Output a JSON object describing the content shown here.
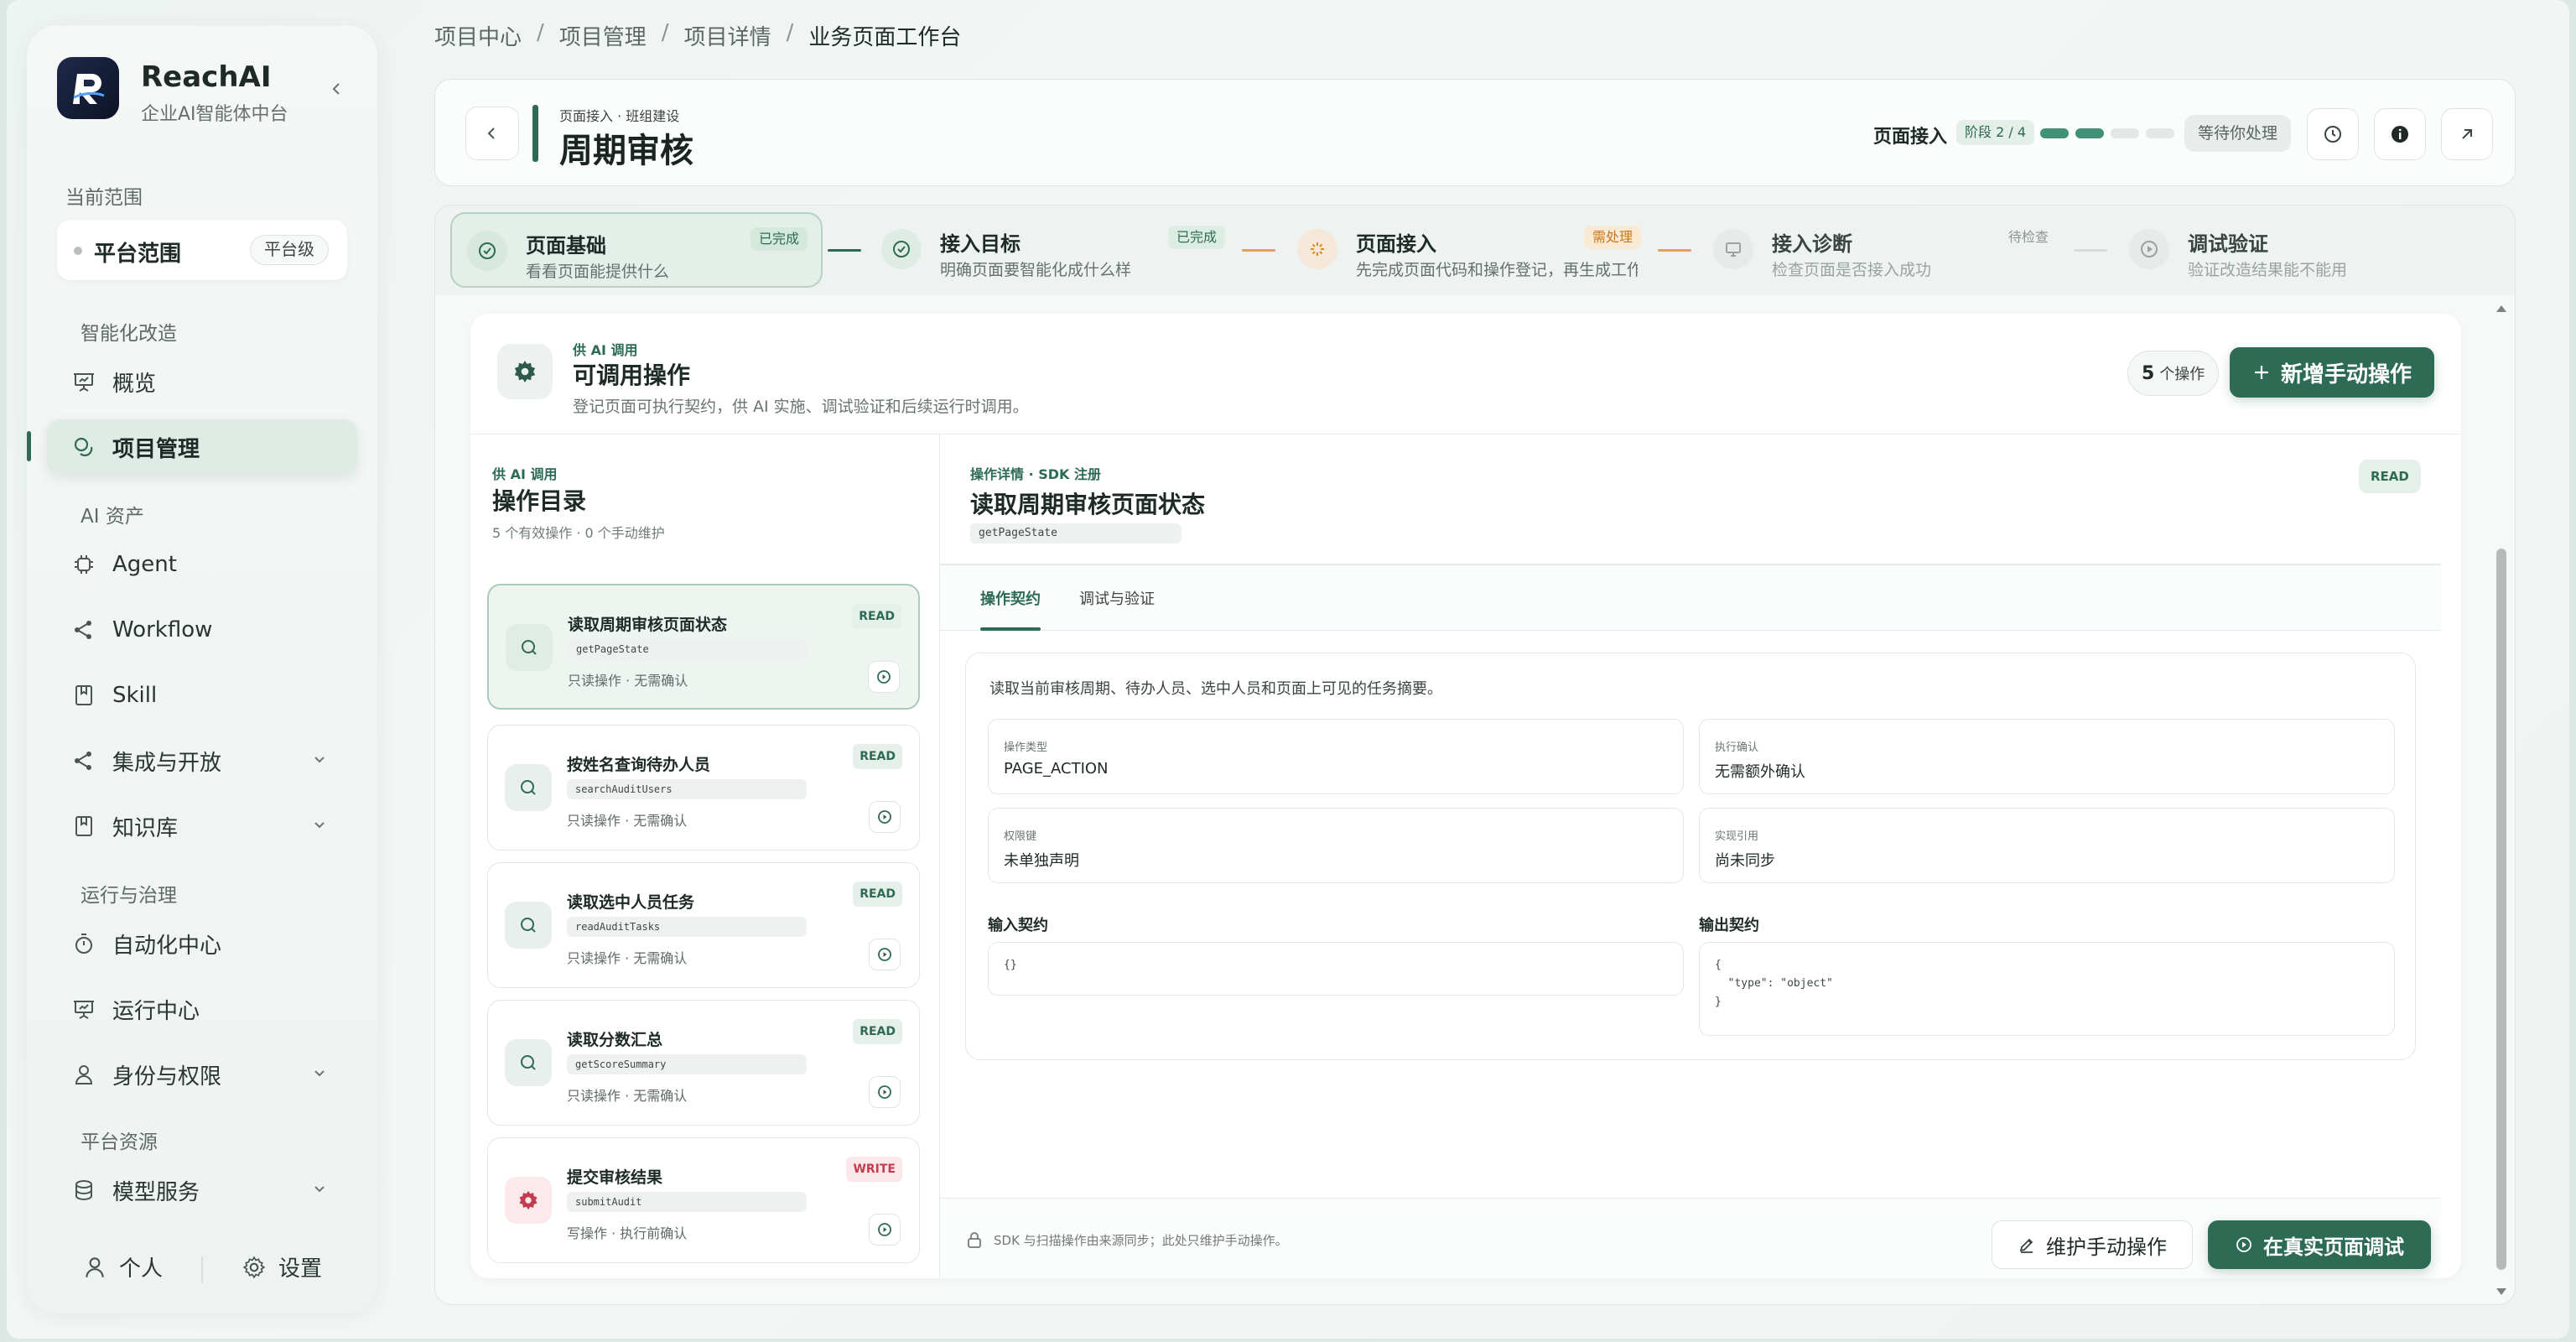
{
  "sidebar": {
    "brand": "ReachAI",
    "brand_sub": "企业AI智能体中台",
    "scope_heading": "当前范围",
    "scope_label": "平台范围",
    "scope_badge": "平台级",
    "sections": [
      "智能化改造",
      "AI 资产",
      "运行与治理",
      "平台资源"
    ],
    "items": [
      {
        "label": "概览",
        "icon": "presentation-icon"
      },
      {
        "label": "项目管理",
        "icon": "chat-bubbles-icon"
      },
      {
        "label": "Agent",
        "icon": "chip-icon"
      },
      {
        "label": "Workflow",
        "icon": "share-icon"
      },
      {
        "label": "Skill",
        "icon": "book-icon"
      },
      {
        "label": "集成与开放",
        "icon": "share-icon"
      },
      {
        "label": "知识库",
        "icon": "book-icon"
      },
      {
        "label": "自动化中心",
        "icon": "timer-icon"
      },
      {
        "label": "运行中心",
        "icon": "presentation-icon"
      },
      {
        "label": "身份与权限",
        "icon": "user-icon"
      },
      {
        "label": "模型服务",
        "icon": "database-icon"
      }
    ],
    "footer": {
      "personal": "个人",
      "settings": "设置"
    }
  },
  "breadcrumb": [
    "项目中心",
    "项目管理",
    "项目详情",
    "业务页面工作台"
  ],
  "header": {
    "subtitle": "页面接入 · 班组建设",
    "title": "周期审核",
    "stage_label": "页面接入",
    "stage_num": "阶段 2 / 4",
    "stage_progress": 0.5,
    "wait_label": "等待你处理"
  },
  "steps": [
    {
      "title": "页面基础",
      "desc": "看看页面能提供什么",
      "badge": "已完成",
      "status": "done"
    },
    {
      "title": "接入目标",
      "desc": "明确页面要智能化成什么样",
      "badge": "已完成",
      "status": "done"
    },
    {
      "title": "页面接入",
      "desc": "先完成页面代码和操作登记，再生成工作...",
      "badge": "需处理",
      "status": "action"
    },
    {
      "title": "接入诊断",
      "desc": "检查页面是否接入成功",
      "badge": "待检查",
      "status": "pending"
    },
    {
      "title": "调试验证",
      "desc": "验证改造结果能不能用",
      "badge": "",
      "status": "pending"
    }
  ],
  "panel": {
    "kicker": "供 AI 调用",
    "title": "可调用操作",
    "desc": "登记页面可执行契约，供 AI 实施、调试验证和后续运行时调用。",
    "count_num": "5",
    "count_unit": "个操作",
    "add_label": "新增手动操作"
  },
  "catalog": {
    "kicker": "供 AI 调用",
    "title": "操作目录",
    "desc": "5 个有效操作 · 0 个手动维护",
    "items": [
      {
        "name": "读取周期审核页面状态",
        "code": "getPageState",
        "meta": "只读操作 · 无需确认",
        "badge": "READ",
        "icon": "search-icon"
      },
      {
        "name": "按姓名查询待办人员",
        "code": "searchAuditUsers",
        "meta": "只读操作 · 无需确认",
        "badge": "READ",
        "icon": "search-icon"
      },
      {
        "name": "读取选中人员任务",
        "code": "readAuditTasks",
        "meta": "只读操作 · 无需确认",
        "badge": "READ",
        "icon": "search-icon"
      },
      {
        "name": "读取分数汇总",
        "code": "getScoreSummary",
        "meta": "只读操作 · 无需确认",
        "badge": "READ",
        "icon": "search-icon"
      },
      {
        "name": "提交审核结果",
        "code": "submitAudit",
        "meta": "写操作 · 执行前确认",
        "badge": "WRITE",
        "icon": "gear-icon"
      }
    ]
  },
  "detail": {
    "kicker": "操作详情 · SDK 注册",
    "title": "读取周期审核页面状态",
    "code": "getPageState",
    "badge": "READ",
    "tabs": [
      "操作契约",
      "调试与验证"
    ],
    "description": "读取当前审核周期、待办人员、选中人员和页面上可见的任务摘要。",
    "fields": [
      {
        "label": "操作类型",
        "value": "PAGE_ACTION"
      },
      {
        "label": "执行确认",
        "value": "无需额外确认"
      },
      {
        "label": "权限键",
        "value": "未单独声明"
      },
      {
        "label": "实现引用",
        "value": "尚未同步"
      }
    ],
    "input_title": "输入契约",
    "input_code": "{}",
    "output_title": "输出契约",
    "output_code": "{\n  \"type\": \"object\"\n}",
    "footer_note": "SDK 与扫描操作由来源同步；此处只维护手动操作。",
    "maintain_label": "维护手动操作",
    "debug_label": "在真实页面调试"
  },
  "colors": {
    "accent": "#2e6b55",
    "warning": "#d98a2b",
    "danger": "#c43b4d"
  }
}
